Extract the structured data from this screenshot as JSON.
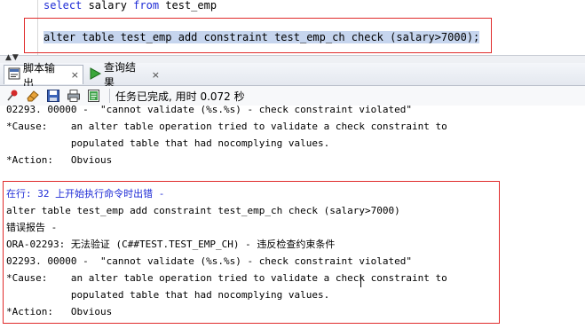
{
  "editor": {
    "line1": {
      "kw1": "select",
      "mid1": " salary ",
      "kw2": "from",
      "rest": " test_emp"
    },
    "line3": "alter table test_emp add constraint test_emp_ch check (salary>7000);"
  },
  "tabs": [
    {
      "label": "脚本输出",
      "icon": "script-output-icon",
      "close": "×"
    },
    {
      "label": "查询结果",
      "icon": "play-icon",
      "close": "×"
    }
  ],
  "toolbar": {
    "status": "任务已完成, 用时 0.072 秒",
    "icons": [
      "pin-icon",
      "eraser-icon",
      "save-icon",
      "print-icon",
      "export-icon"
    ]
  },
  "output": {
    "lines": [
      {
        "text": "02293. 00000 -  \"cannot validate (%s.%s) - check constraint violated\"",
        "color": "black"
      },
      {
        "text": "*Cause:    an alter table operation tried to validate a check constraint to",
        "color": "black"
      },
      {
        "text": "           populated table that had nocomplying values.",
        "color": "black"
      },
      {
        "text": "*Action:   Obvious",
        "color": "black"
      },
      {
        "text": "",
        "color": "black"
      },
      {
        "text": "在行: 32 上开始执行命令时出错 -",
        "color": "blue"
      },
      {
        "text": "alter table test_emp add constraint test_emp_ch check (salary>7000)",
        "color": "black"
      },
      {
        "text": "错误报告 -",
        "color": "black"
      },
      {
        "text": "ORA-02293: 无法验证 (C##TEST.TEST_EMP_CH) - 违反检查约束条件",
        "color": "black"
      },
      {
        "text": "02293. 00000 -  \"cannot validate (%s.%s) - check constraint violated\"",
        "color": "black"
      },
      {
        "text": "*Cause:    an alter table operation tried to validate a check constraint to",
        "color": "black"
      },
      {
        "text": "           populated table that had nocomplying values.",
        "color": "black"
      },
      {
        "text": "*Action:   Obvious",
        "color": "black"
      }
    ]
  },
  "colors": {
    "keyword": "#1e2bd6",
    "selection": "#c6d5ee",
    "highlight_box": "#e02b2b",
    "error_header": "#1e2bd6"
  }
}
